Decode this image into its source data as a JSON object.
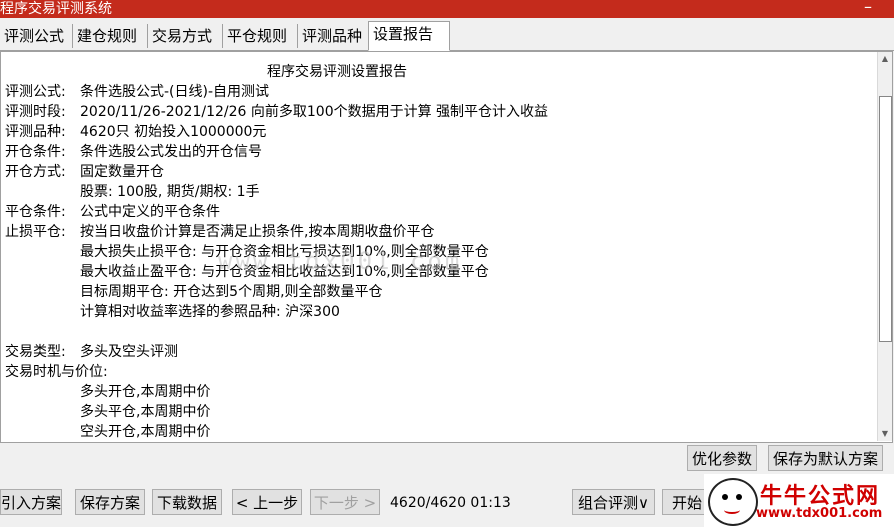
{
  "window": {
    "title": "程序交易评测系统",
    "minimize_glyph": "–"
  },
  "tabs": [
    "评测公式",
    "建仓规则",
    "交易方式",
    "平仓规则",
    "评测品种",
    "设置报告"
  ],
  "active_tab": 5,
  "report": {
    "header": "程序交易评测设置报告",
    "lines": [
      {
        "k": "评测公式:",
        "v": "条件选股公式-(日线)-自用测试"
      },
      {
        "k": "评测时段:",
        "v": "2020/11/26-2021/12/26 向前多取100个数据用于计算 强制平仓计入收益"
      },
      {
        "k": "评测品种:",
        "v": "4620只 初始投入1000000元"
      },
      {
        "k": "开仓条件:",
        "v": "条件选股公式发出的开仓信号"
      },
      {
        "k": "开仓方式:",
        "v": "固定数量开仓"
      },
      {
        "k": "",
        "v": "股票: 100股, 期货/期权: 1手"
      },
      {
        "k": "平仓条件:",
        "v": "公式中定义的平仓条件"
      },
      {
        "k": "止损平仓:",
        "v": "按当日收盘价计算是否满足止损条件,按本周期收盘价平仓"
      },
      {
        "k": "",
        "v": "最大损失止损平仓: 与开仓资金相比亏损达到10%,则全部数量平仓"
      },
      {
        "k": "",
        "v": "最大收益止盈平仓: 与开仓资金相比收益达到10%,则全部数量平仓"
      },
      {
        "k": "",
        "v": "目标周期平仓: 开仓达到5个周期,则全部数量平仓"
      },
      {
        "k": "",
        "v": "计算相对收益率选择的参照品种: 沪深300"
      },
      {
        "k": "",
        "v": ""
      },
      {
        "k": "交易类型:",
        "v": "多头及空头评测"
      },
      {
        "k": "交易时机与价位:",
        "v": ""
      },
      {
        "k": "",
        "v": "多头开仓,本周期中价"
      },
      {
        "k": "",
        "v": "多头平仓,本周期中价"
      },
      {
        "k": "",
        "v": "空头开仓,本周期中价"
      }
    ]
  },
  "buttons": {
    "optimize": "优化参数",
    "save_default": "保存为默认方案",
    "import": "引入方案",
    "save": "保存方案",
    "download": "下载数据",
    "prev": "< 上一步",
    "next": "下一步 >",
    "combo": "组合评测∨",
    "start": "开始"
  },
  "status": "4620/4620 01:13",
  "watermark": "www.tdx001.com",
  "logo": {
    "name": "牛牛公式网",
    "url": "www.tdx001.com"
  },
  "colors": {
    "titlebar": "#c42b1c",
    "logo_red": "#d00000"
  }
}
